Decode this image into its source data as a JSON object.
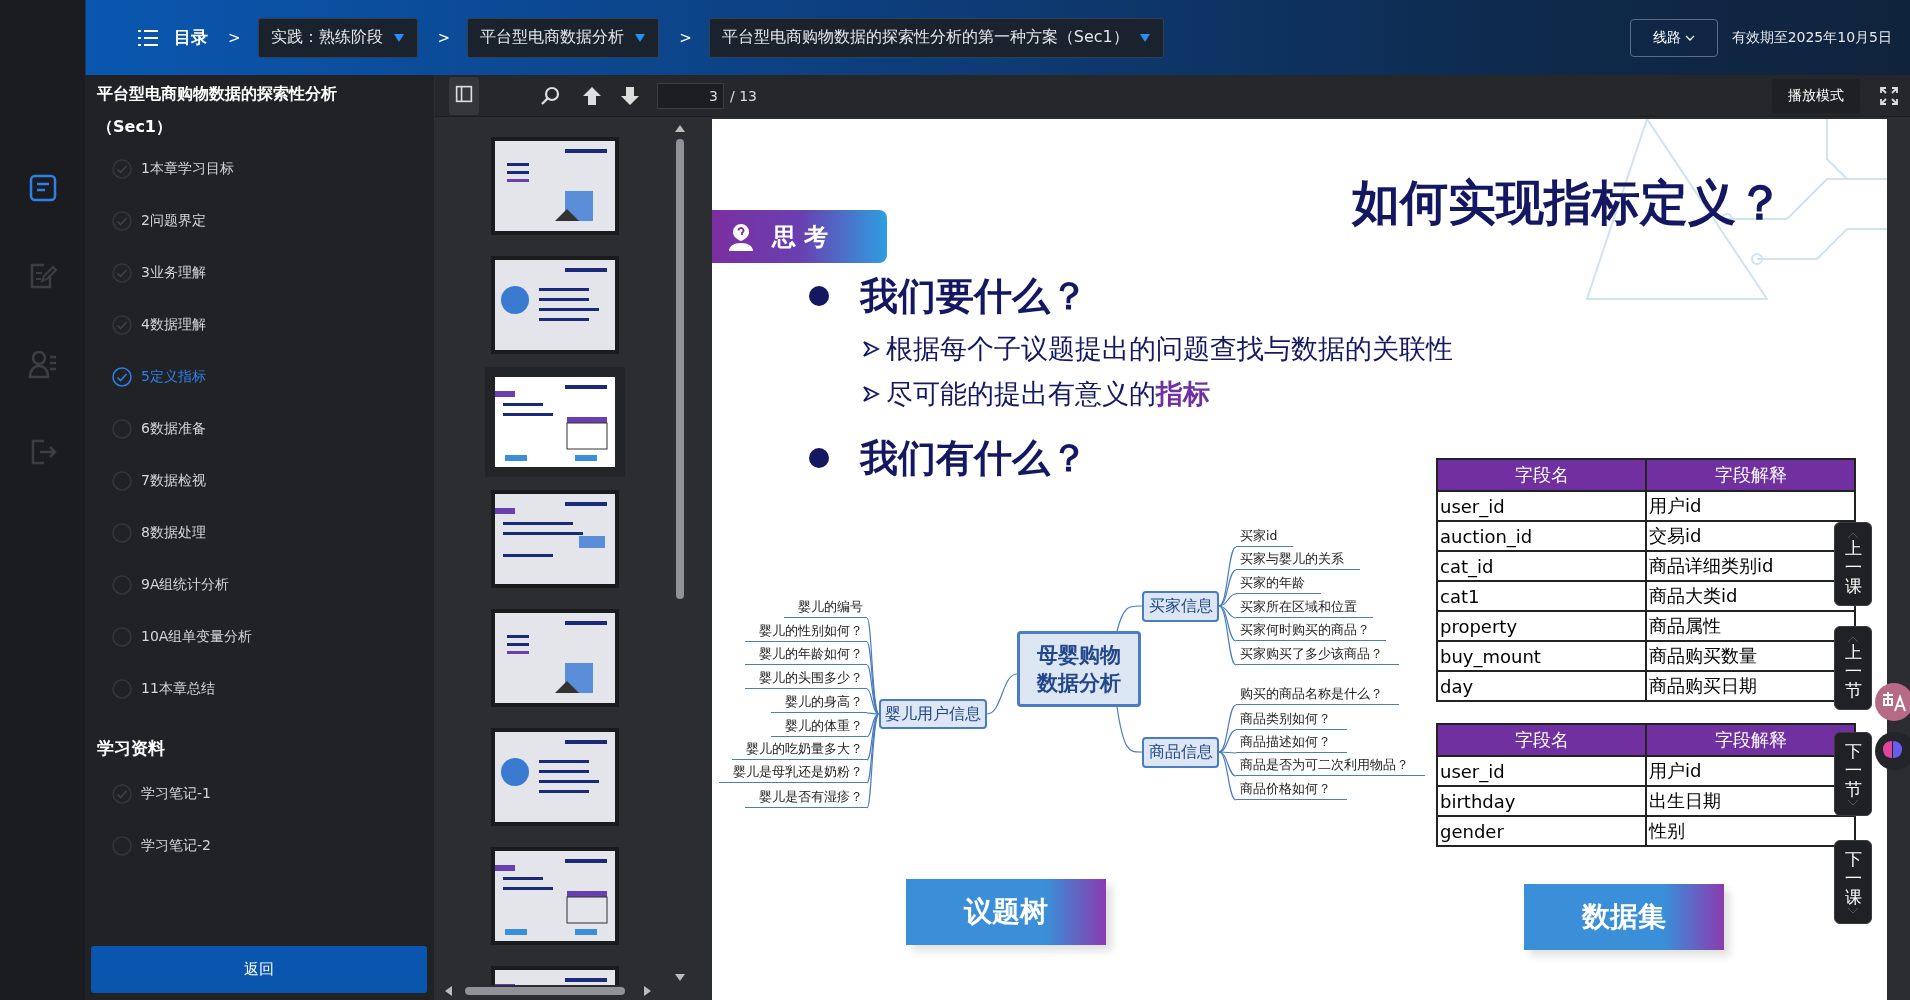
{
  "topbar": {
    "catalog_label": "目录",
    "breadcrumbs": [
      {
        "separator": ">",
        "label": "实践：熟练阶段"
      },
      {
        "separator": ">",
        "label": "平台型电商数据分析"
      },
      {
        "separator": ">",
        "label": "平台型电商购物数据的探索性分析的第一种方案（Sec1）"
      }
    ],
    "route_button": "线路",
    "validity": "有效期至2025年10月5日"
  },
  "rail": [
    {
      "kind": "outline",
      "selected": true
    },
    {
      "kind": "notes",
      "selected": false
    },
    {
      "kind": "people",
      "selected": false
    },
    {
      "kind": "exit",
      "selected": false
    }
  ],
  "sidebar": {
    "title": "平台型电商购物数据的探索性分析（Sec1）",
    "chapters": [
      {
        "label": "1本章学习目标",
        "done": true,
        "selected": false
      },
      {
        "label": "2问题界定",
        "done": true,
        "selected": false
      },
      {
        "label": "3业务理解",
        "done": true,
        "selected": false
      },
      {
        "label": "4数据理解",
        "done": true,
        "selected": false
      },
      {
        "label": "5定义指标",
        "done": true,
        "selected": true
      },
      {
        "label": "6数据准备",
        "done": false,
        "selected": false
      },
      {
        "label": "7数据检视",
        "done": false,
        "selected": false
      },
      {
        "label": "8数据处理",
        "done": false,
        "selected": false
      },
      {
        "label": "9A组统计分析",
        "done": false,
        "selected": false
      },
      {
        "label": "10A组单变量分析",
        "done": false,
        "selected": false
      },
      {
        "label": "11本章总结",
        "done": false,
        "selected": false
      }
    ],
    "materials_title": "学习资料",
    "materials": [
      {
        "label": "学习笔记-1",
        "done": true,
        "selected": false
      },
      {
        "label": "学习笔记-2",
        "done": false,
        "selected": false
      }
    ],
    "back_button": "返回"
  },
  "toolbar": {
    "page": "3",
    "page_total": "/ 13",
    "play_mode": "播放模式"
  },
  "thumbnails": [
    {
      "selected": false
    },
    {
      "selected": false
    },
    {
      "selected": true
    },
    {
      "selected": false
    },
    {
      "selected": false
    },
    {
      "selected": false
    },
    {
      "selected": false
    },
    {
      "selected": false
    }
  ],
  "slide": {
    "title": "如何实现指标定义？",
    "badge": "思 考",
    "sections": [
      {
        "heading": "我们要什么？",
        "points": [
          "根据每个子议题提出的问题查找与数据的关联性",
          "尽可能的提出有意义的**指标**"
        ]
      },
      {
        "heading": "我们有什么？"
      }
    ],
    "mind_map": {
      "center": "母婴购物数据分析",
      "branches": [
        {
          "label": "婴儿用户信息",
          "kind": "left",
          "children": [
            {
              "label": "婴儿的编号"
            },
            {
              "label": "婴儿的性别如何？"
            },
            {
              "label": "婴儿的年龄如何？"
            },
            {
              "label": "婴儿的头围多少？"
            },
            {
              "label": "婴儿的身高？"
            },
            {
              "label": "婴儿的体重？"
            },
            {
              "label": "婴儿的吃奶量多大？"
            },
            {
              "label": "婴儿是母乳还是奶粉？"
            },
            {
              "label": "婴儿是否有湿疹？"
            }
          ]
        },
        {
          "label": "买家信息",
          "kind": "right",
          "children": [
            {
              "label": "买家id"
            },
            {
              "label": "买家与婴儿的关系"
            },
            {
              "label": "买家的年龄"
            },
            {
              "label": "买家所在区域和位置"
            },
            {
              "label": "买家何时购买的商品？"
            },
            {
              "label": "买家购买了多少该商品？"
            }
          ]
        },
        {
          "label": "商品信息",
          "kind": "right",
          "children": [
            {
              "label": "购买的商品名称是什么？"
            },
            {
              "label": "商品类别如何？"
            },
            {
              "label": "商品描述如何？"
            },
            {
              "label": "商品是否为可二次利用物品？"
            },
            {
              "label": "商品价格如何？"
            }
          ]
        }
      ]
    },
    "tables": [
      {
        "columns": [
          "字段名",
          "字段解释"
        ],
        "rows": [
          [
            "user_id",
            "用户id"
          ],
          [
            "auction_id",
            "交易id"
          ],
          [
            "cat_id",
            "商品详细类别id"
          ],
          [
            "cat1",
            "商品大类id"
          ],
          [
            "property",
            "商品属性"
          ],
          [
            "buy_mount",
            "商品购买数量"
          ],
          [
            "day",
            "商品购买日期"
          ]
        ]
      },
      {
        "columns": [
          "字段名",
          "字段解释"
        ],
        "rows": [
          [
            "user_id",
            "用户id"
          ],
          [
            "birthday",
            "出生日期"
          ],
          [
            "gender",
            "性别"
          ]
        ]
      }
    ],
    "labels": [
      "议题树",
      "数据集"
    ]
  },
  "nav_buttons": [
    {
      "label": "上一课",
      "kind": "up"
    },
    {
      "label": "上一节",
      "kind": "up"
    },
    {
      "label": "下一节",
      "kind": "down"
    },
    {
      "label": "下一课",
      "kind": "down"
    }
  ]
}
